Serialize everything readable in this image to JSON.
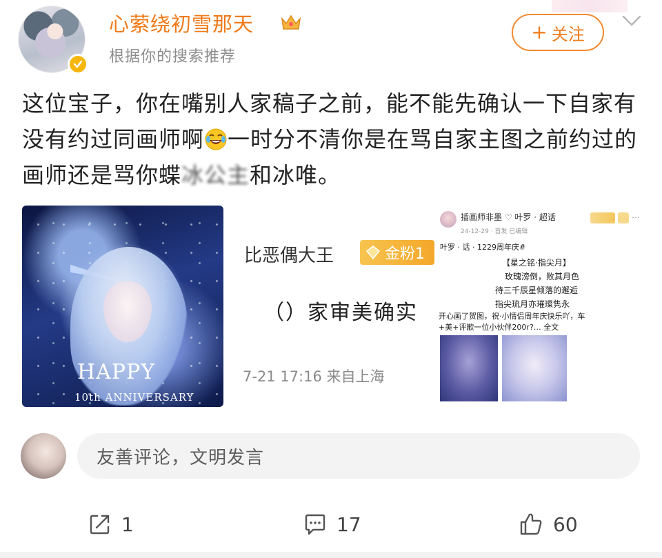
{
  "header": {
    "username": "心萦绕初雪那天",
    "recommendation": "根据你的搜索推荐",
    "follow_label": "关注"
  },
  "post": {
    "text_before_emoji": "这位宝子，你在嘴别人家稿子之前，能不能先确认一下自家有没有约过同画师啊",
    "text_after_emoji": "一时分不清你是在骂自家主图之前约过的画师还是骂你蝶",
    "text_censored": "冰公主",
    "text_end": "和冰唯。"
  },
  "image1": {
    "happy": "HAPPY",
    "anniversary": "10th ANNIVERSARY"
  },
  "quoted": {
    "name": "比恶偶大王",
    "badge": "金粉1",
    "text": "（）家审美确实",
    "meta": "7-21 17:16 来自上海"
  },
  "screenshot": {
    "author": "插画师非墨 ♡ 叶罗 · 超话",
    "date": "24-12-29 · 首发 已编辑",
    "tagline": "叶罗 · 话 · 1229周年庆#",
    "title": "【星之铭·指尖月】",
    "lines": [
      "玫瑰滂倒，败其月色",
      "待三千辰星倾落的邂逅",
      "指尖琉月亦璀璨隽永"
    ],
    "desc1": "开心画了贺图，祝·小情侣周年庆快乐吖，车",
    "desc2": "+美+评歉一位小伙伴200r?… 全文"
  },
  "comment": {
    "placeholder": "友善评论，文明发言"
  },
  "actions": {
    "repost_count": "1",
    "comment_count": "17",
    "like_count": "60"
  },
  "colors": {
    "username": "#f07a18",
    "follow_border": "#f28a2e",
    "verified": "#f6b60c",
    "gold_badge": "#f4a72a"
  }
}
